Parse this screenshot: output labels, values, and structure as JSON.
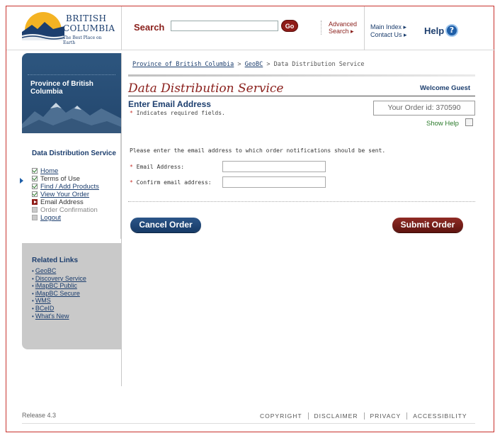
{
  "header": {
    "logo_line1": "BRITISH",
    "logo_line2": "COLUMBIA",
    "logo_tagline": "The Best Place on Earth",
    "search_label": "Search",
    "search_value": "",
    "go_label": "Go",
    "advanced_line1": "Advanced",
    "advanced_line2": "Search ▸",
    "main_index": "Main Index ▸",
    "contact_us": "Contact Us ▸",
    "help_label": "Help",
    "help_icon": "?"
  },
  "sidebar": {
    "banner_title": "Province of British Columbia",
    "section_title": "Data Distribution Service",
    "nav": [
      {
        "label": "Home",
        "state": "checked",
        "link": true
      },
      {
        "label": "Terms of Use",
        "state": "checked",
        "link": false
      },
      {
        "label": "Find / Add Products",
        "state": "checked",
        "link": true
      },
      {
        "label": "View Your Order",
        "state": "checked",
        "link": true
      },
      {
        "label": "Email Address",
        "state": "current",
        "link": false
      },
      {
        "label": "Order Confirmation",
        "state": "pending",
        "link": false
      },
      {
        "label": "Logout",
        "state": "pending",
        "link": true
      }
    ],
    "related_title": "Related Links",
    "related_links": [
      "GeoBC",
      "Discovery Service",
      "iMapBC Public",
      "iMapBC Secure",
      "WMS",
      "BCeID",
      "What's New"
    ]
  },
  "breadcrumb": {
    "level1": "Province of British Columbia",
    "sep": " > ",
    "level2": "GeoBC",
    "current": "Data Distribution Service"
  },
  "main": {
    "page_title": "Data Distribution Service",
    "welcome": "Welcome Guest",
    "sub_title": "Enter Email Address",
    "required_star": "*",
    "required_text": " Indicates required fields.",
    "order_id_text": "Your Order id: 370590",
    "show_help": "Show Help",
    "instructions": "Please enter the email address to which order notifications should be sent.",
    "email_label": " Email Address:",
    "confirm_label": " Confirm email address:",
    "email_value": "",
    "confirm_value": "",
    "cancel_label": "Cancel Order",
    "submit_label": "Submit Order"
  },
  "footer": {
    "release": "Release 4.3",
    "links": [
      "COPYRIGHT",
      "DISCLAIMER",
      "PRIVACY",
      "ACCESSIBILITY"
    ]
  },
  "colors": {
    "brand_red": "#8a1f1b",
    "brand_blue": "#1c3e6e",
    "frame_border": "#c8332e"
  }
}
